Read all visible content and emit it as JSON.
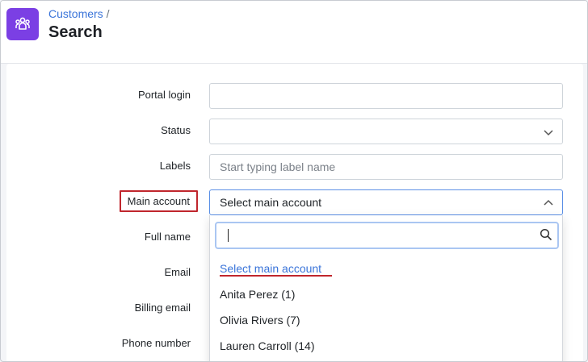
{
  "header": {
    "breadcrumb_parent": "Customers",
    "breadcrumb_separator": "/",
    "title": "Search",
    "app_icon": "users-group-icon",
    "accent": "#7b3fe4"
  },
  "form": {
    "portal_login": {
      "label": "Portal login",
      "value": ""
    },
    "status": {
      "label": "Status",
      "value": ""
    },
    "labels": {
      "label": "Labels",
      "placeholder": "Start typing label name"
    },
    "main_account": {
      "label": "Main account",
      "value": "Select main account"
    },
    "full_name": {
      "label": "Full name"
    },
    "email": {
      "label": "Email"
    },
    "billing_email": {
      "label": "Billing email"
    },
    "phone_number": {
      "label": "Phone number"
    }
  },
  "dropdown": {
    "search_value": "",
    "options": [
      {
        "label": "Select main account",
        "selected": true
      },
      {
        "label": "Anita Perez (1)"
      },
      {
        "label": "Olivia Rivers (7)"
      },
      {
        "label": "Lauren Carroll (14)"
      }
    ]
  }
}
